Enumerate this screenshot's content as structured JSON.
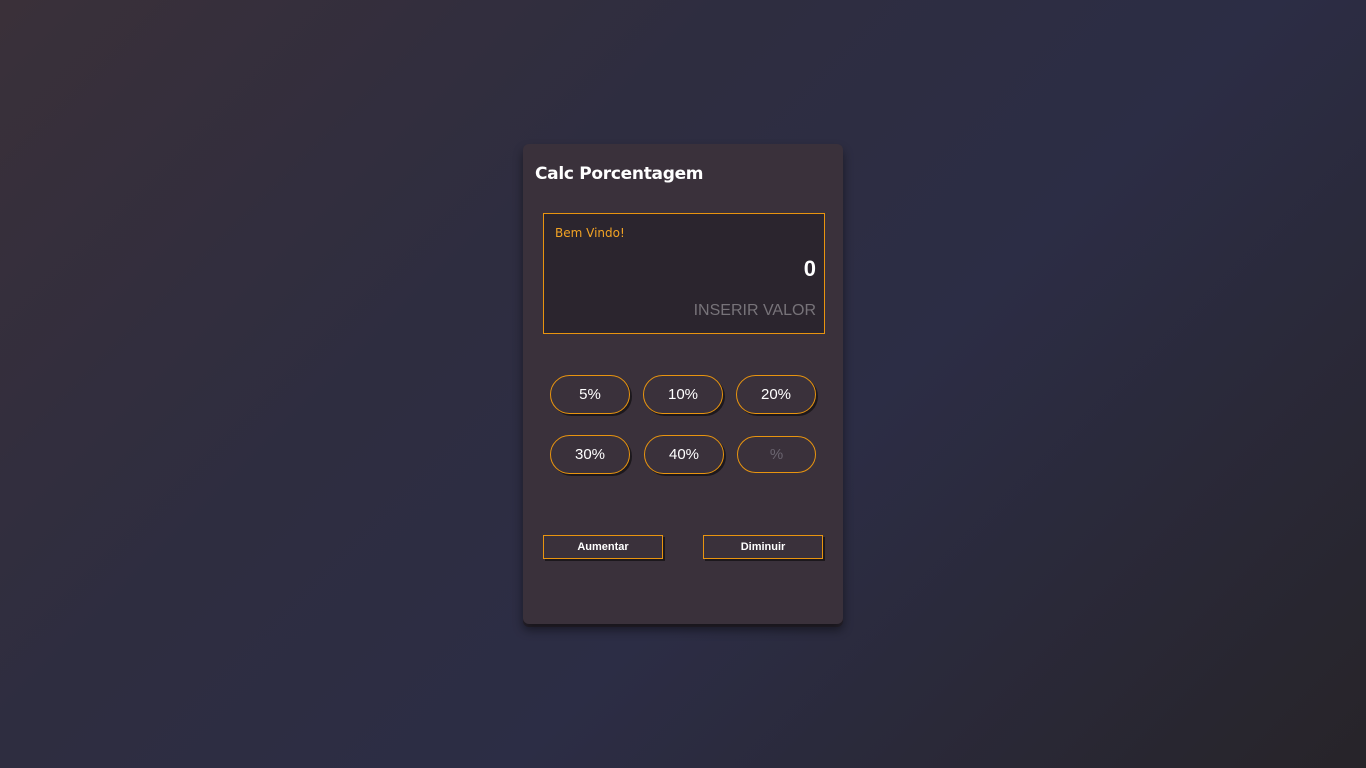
{
  "app": {
    "title": "Calc Porcentagem"
  },
  "display": {
    "welcome": "Bem Vindo!",
    "result": "0",
    "input_placeholder": "INSERIR VALOR",
    "input_value": ""
  },
  "percent_buttons": [
    {
      "label": "5%"
    },
    {
      "label": "10%"
    },
    {
      "label": "20%"
    },
    {
      "label": "30%"
    },
    {
      "label": "40%"
    }
  ],
  "custom_percent": {
    "placeholder": "%",
    "value": ""
  },
  "actions": {
    "increase_label": "Aumentar",
    "decrease_label": "Diminuir"
  },
  "colors": {
    "accent": "#e8940f",
    "welcome_text": "#f2a324",
    "card_background": "#3a313b",
    "display_background": "#2b252e"
  }
}
